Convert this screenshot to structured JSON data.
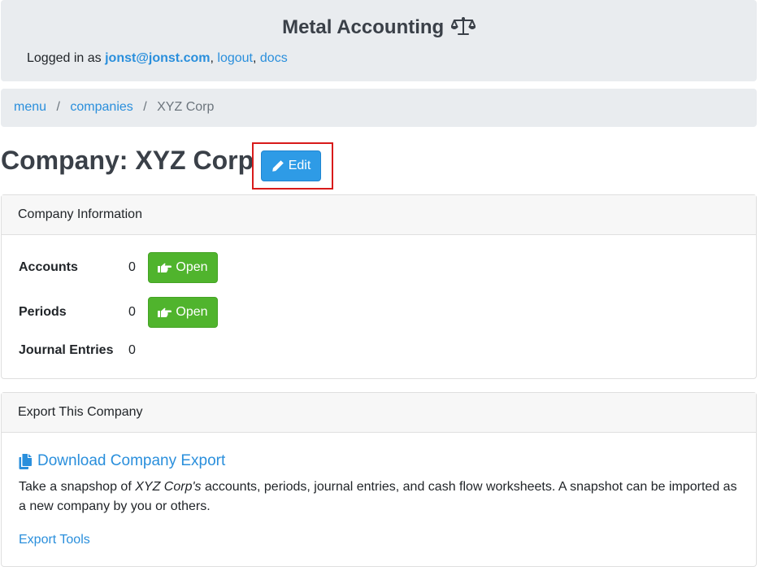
{
  "header": {
    "title": "Metal Accounting",
    "login_prefix": "Logged in as",
    "user_email": "jonst@jonst.com",
    "comma1": ",",
    "logout_label": "logout",
    "comma2": ",",
    "docs_label": "docs"
  },
  "breadcrumb": {
    "items": [
      {
        "label": "menu"
      },
      {
        "label": "companies"
      }
    ],
    "separator": "/",
    "current": "XYZ Corp"
  },
  "page": {
    "title": "Company: XYZ Corp",
    "edit_label": "Edit"
  },
  "company_info": {
    "header": "Company Information",
    "rows": [
      {
        "label": "Accounts",
        "value": "0",
        "button": "Open"
      },
      {
        "label": "Periods",
        "value": "0",
        "button": "Open"
      },
      {
        "label": "Journal Entries",
        "value": "0"
      }
    ]
  },
  "export": {
    "header": "Export This Company",
    "download_label": "Download Company Export",
    "desc_prefix": "Take a snapshop of",
    "desc_company": "XYZ Corp's",
    "desc_suffix": "accounts, periods, journal entries, and cash flow worksheets. A snapshot can be imported as a new company by you or others.",
    "tools_label": "Export Tools"
  },
  "colors": {
    "primary": "#2e9be6",
    "success": "#50b42d",
    "link": "#2a8fdc",
    "highlight": "#d81b1b"
  }
}
